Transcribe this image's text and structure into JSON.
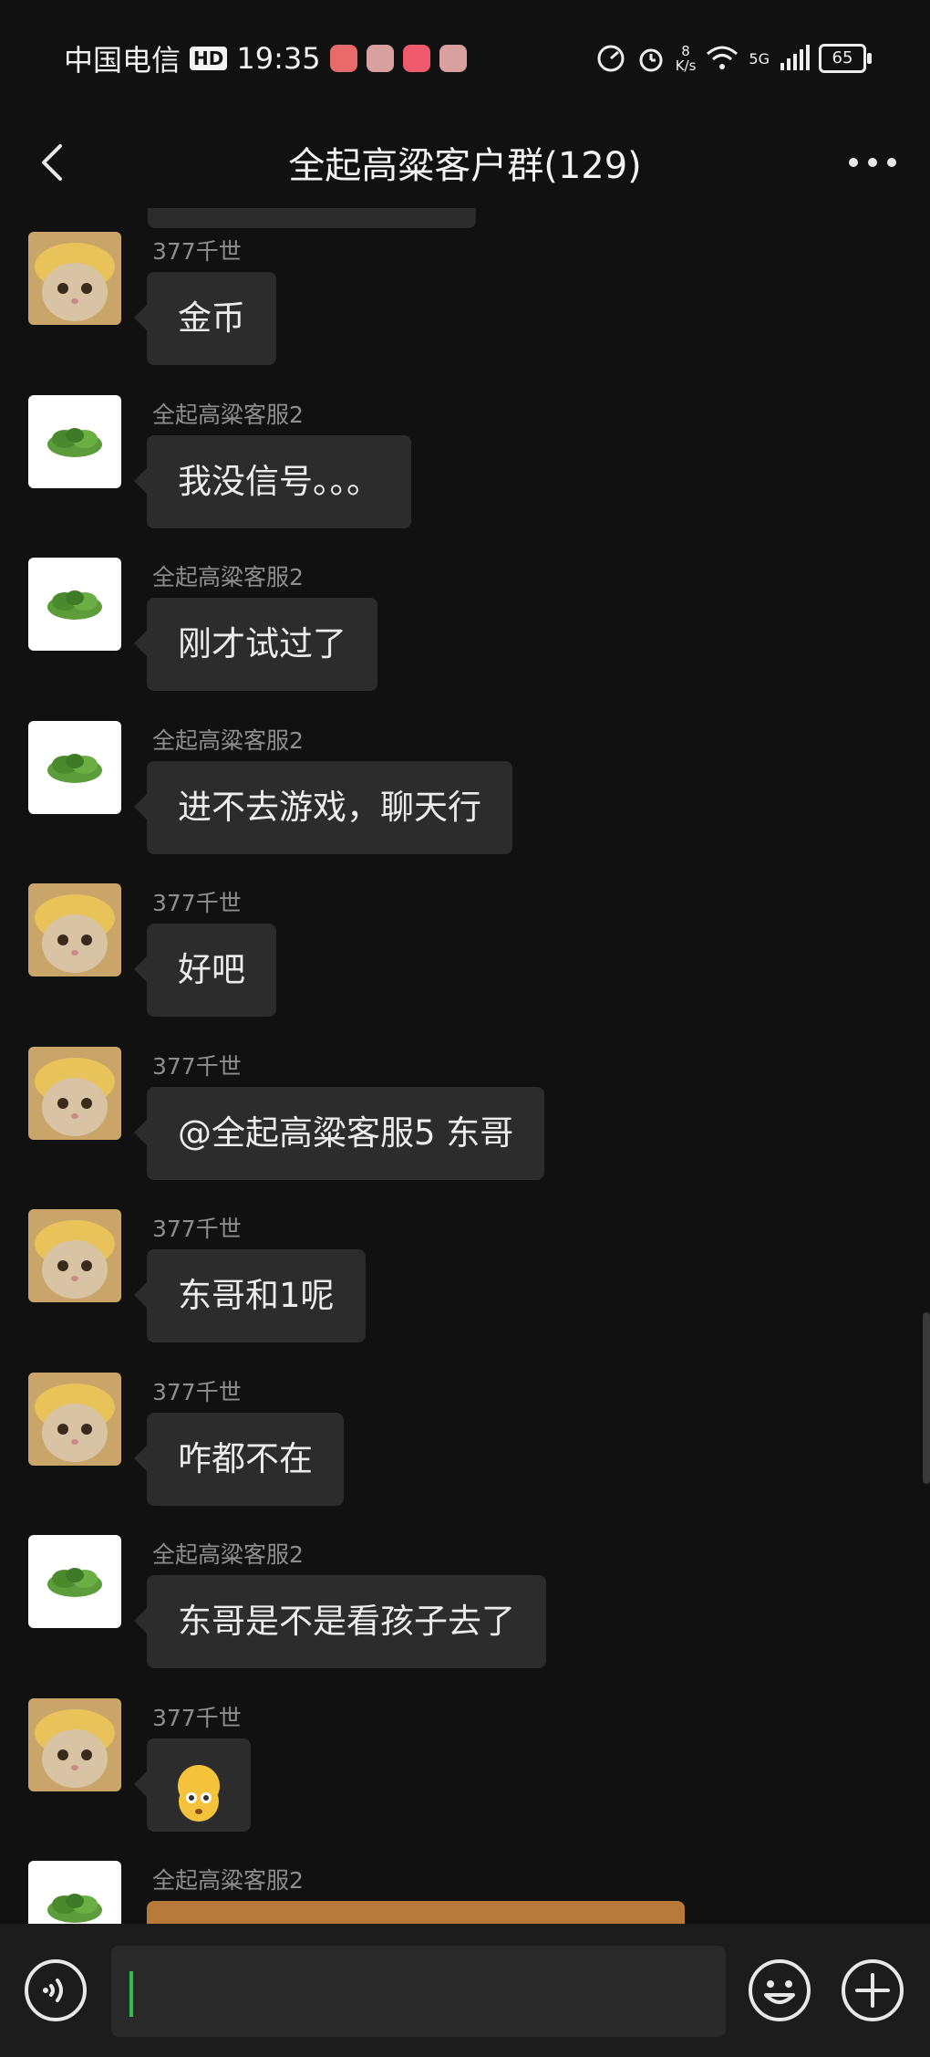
{
  "status_bar": {
    "carrier": "中国电信",
    "hd": "HD",
    "time": "19:35",
    "speed_value": "8",
    "speed_unit": "K/s",
    "network": "5G",
    "battery": "65"
  },
  "header": {
    "title": "全起高粱客户群(129)",
    "back_icon": "chevron-left-icon",
    "more_icon": "ellipsis-icon"
  },
  "messages": [
    {
      "sender": "377千世",
      "text": "金币",
      "avatar": "cat-avatar"
    },
    {
      "sender": "全起高粱客服2",
      "text": "我没信号。。。",
      "avatar": "leaf-avatar"
    },
    {
      "sender": "全起高粱客服2",
      "text": "刚才试过了",
      "avatar": "leaf-avatar"
    },
    {
      "sender": "全起高粱客服2",
      "text": "进不去游戏，聊天行",
      "avatar": "leaf-avatar"
    },
    {
      "sender": "377千世",
      "text": "好吧",
      "avatar": "cat-avatar"
    },
    {
      "sender": "377千世",
      "text": "@全起高粱客服5 东哥",
      "avatar": "cat-avatar"
    },
    {
      "sender": "377千世",
      "text": "东哥和1呢",
      "avatar": "cat-avatar"
    },
    {
      "sender": "377千世",
      "text": "咋都不在",
      "avatar": "cat-avatar"
    },
    {
      "sender": "全起高粱客服2",
      "text": "东哥是不是看孩子去了",
      "avatar": "leaf-avatar"
    },
    {
      "sender": "377千世",
      "text": "",
      "emoji": "flushed-face-emoji",
      "avatar": "cat-avatar"
    },
    {
      "sender": "全起高粱客服2",
      "text": "",
      "avatar": "leaf-avatar",
      "bubble_color": "#b77a3a"
    }
  ],
  "input_bar": {
    "voice_icon": "voice-icon",
    "emoji_icon": "emoji-icon",
    "plus_icon": "plus-icon",
    "caret_color": "#30c04a"
  },
  "colors": {
    "background": "#111111",
    "bubble": "#2c2c2c",
    "sender_text": "#8e8e8e"
  }
}
